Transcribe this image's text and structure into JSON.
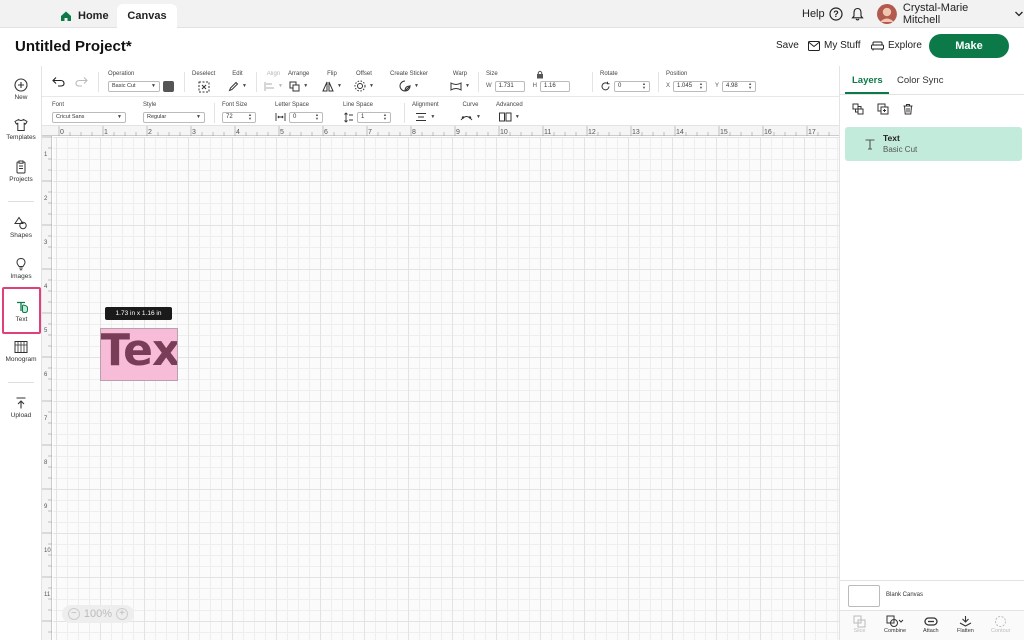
{
  "tabs": {
    "home": "Home",
    "canvas": "Canvas"
  },
  "topbar": {
    "help": "Help",
    "user_name": "Crystal-Marie Mitchell"
  },
  "header": {
    "title": "Untitled Project*",
    "save": "Save",
    "my_stuff": "My Stuff",
    "explore": "Explore",
    "make": "Make"
  },
  "leftbar": {
    "new": "New",
    "templates": "Templates",
    "projects": "Projects",
    "shapes": "Shapes",
    "images": "Images",
    "text": "Text",
    "monogram": "Monogram",
    "upload": "Upload"
  },
  "toolbar": {
    "operation_label": "Operation",
    "operation_value": "Basic Cut",
    "deselect": "Deselect",
    "edit": "Edit",
    "align": "Align",
    "arrange": "Arrange",
    "flip": "Flip",
    "offset": "Offset",
    "create_sticker": "Create Sticker",
    "warp": "Warp",
    "size_label": "Size",
    "w_label": "W",
    "w_value": "1.731",
    "h_label": "H",
    "h_value": "1.16",
    "rotate_label": "Rotate",
    "rotate_value": "0",
    "position_label": "Position",
    "x_label": "X",
    "x_value": "1.045",
    "y_label": "Y",
    "y_value": "4.98"
  },
  "text_toolbar": {
    "font_label": "Font",
    "font_value": "Cricut Sans",
    "style_label": "Style",
    "style_value": "Regular",
    "font_size_label": "Font Size",
    "font_size_value": "72",
    "letter_space_label": "Letter Space",
    "letter_space_value": "0",
    "line_space_label": "Line Space",
    "line_space_value": "1",
    "alignment_label": "Alignment",
    "curve_label": "Curve",
    "advanced_label": "Advanced"
  },
  "ruler": {
    "top": [
      "0",
      "1",
      "2",
      "3",
      "4",
      "5",
      "6",
      "7",
      "8",
      "9",
      "10",
      "11",
      "12",
      "13",
      "14",
      "15",
      "16",
      "17"
    ],
    "left": [
      "1",
      "2",
      "3",
      "4",
      "5",
      "6",
      "7",
      "8",
      "9",
      "10",
      "11"
    ]
  },
  "canvas": {
    "dimension_tip": "1.73  in x 1.16  in",
    "text_object": "Text",
    "zoom": "100%"
  },
  "right_panel": {
    "tab_layers": "Layers",
    "tab_color_sync": "Color Sync",
    "layer_name": "Text",
    "layer_sub": "Basic Cut",
    "blank_canvas": "Blank Canvas",
    "tools": {
      "slice": "Slice",
      "combine": "Combine",
      "attach": "Attach",
      "flatten": "Flatten",
      "contour": "Contour"
    }
  },
  "colors": {
    "accent": "#0b7a48",
    "layer_selected": "#c3ebdc",
    "text_fill": "#f7bcd8",
    "text_color": "#7a3d57",
    "highlight": "#e0407a"
  }
}
